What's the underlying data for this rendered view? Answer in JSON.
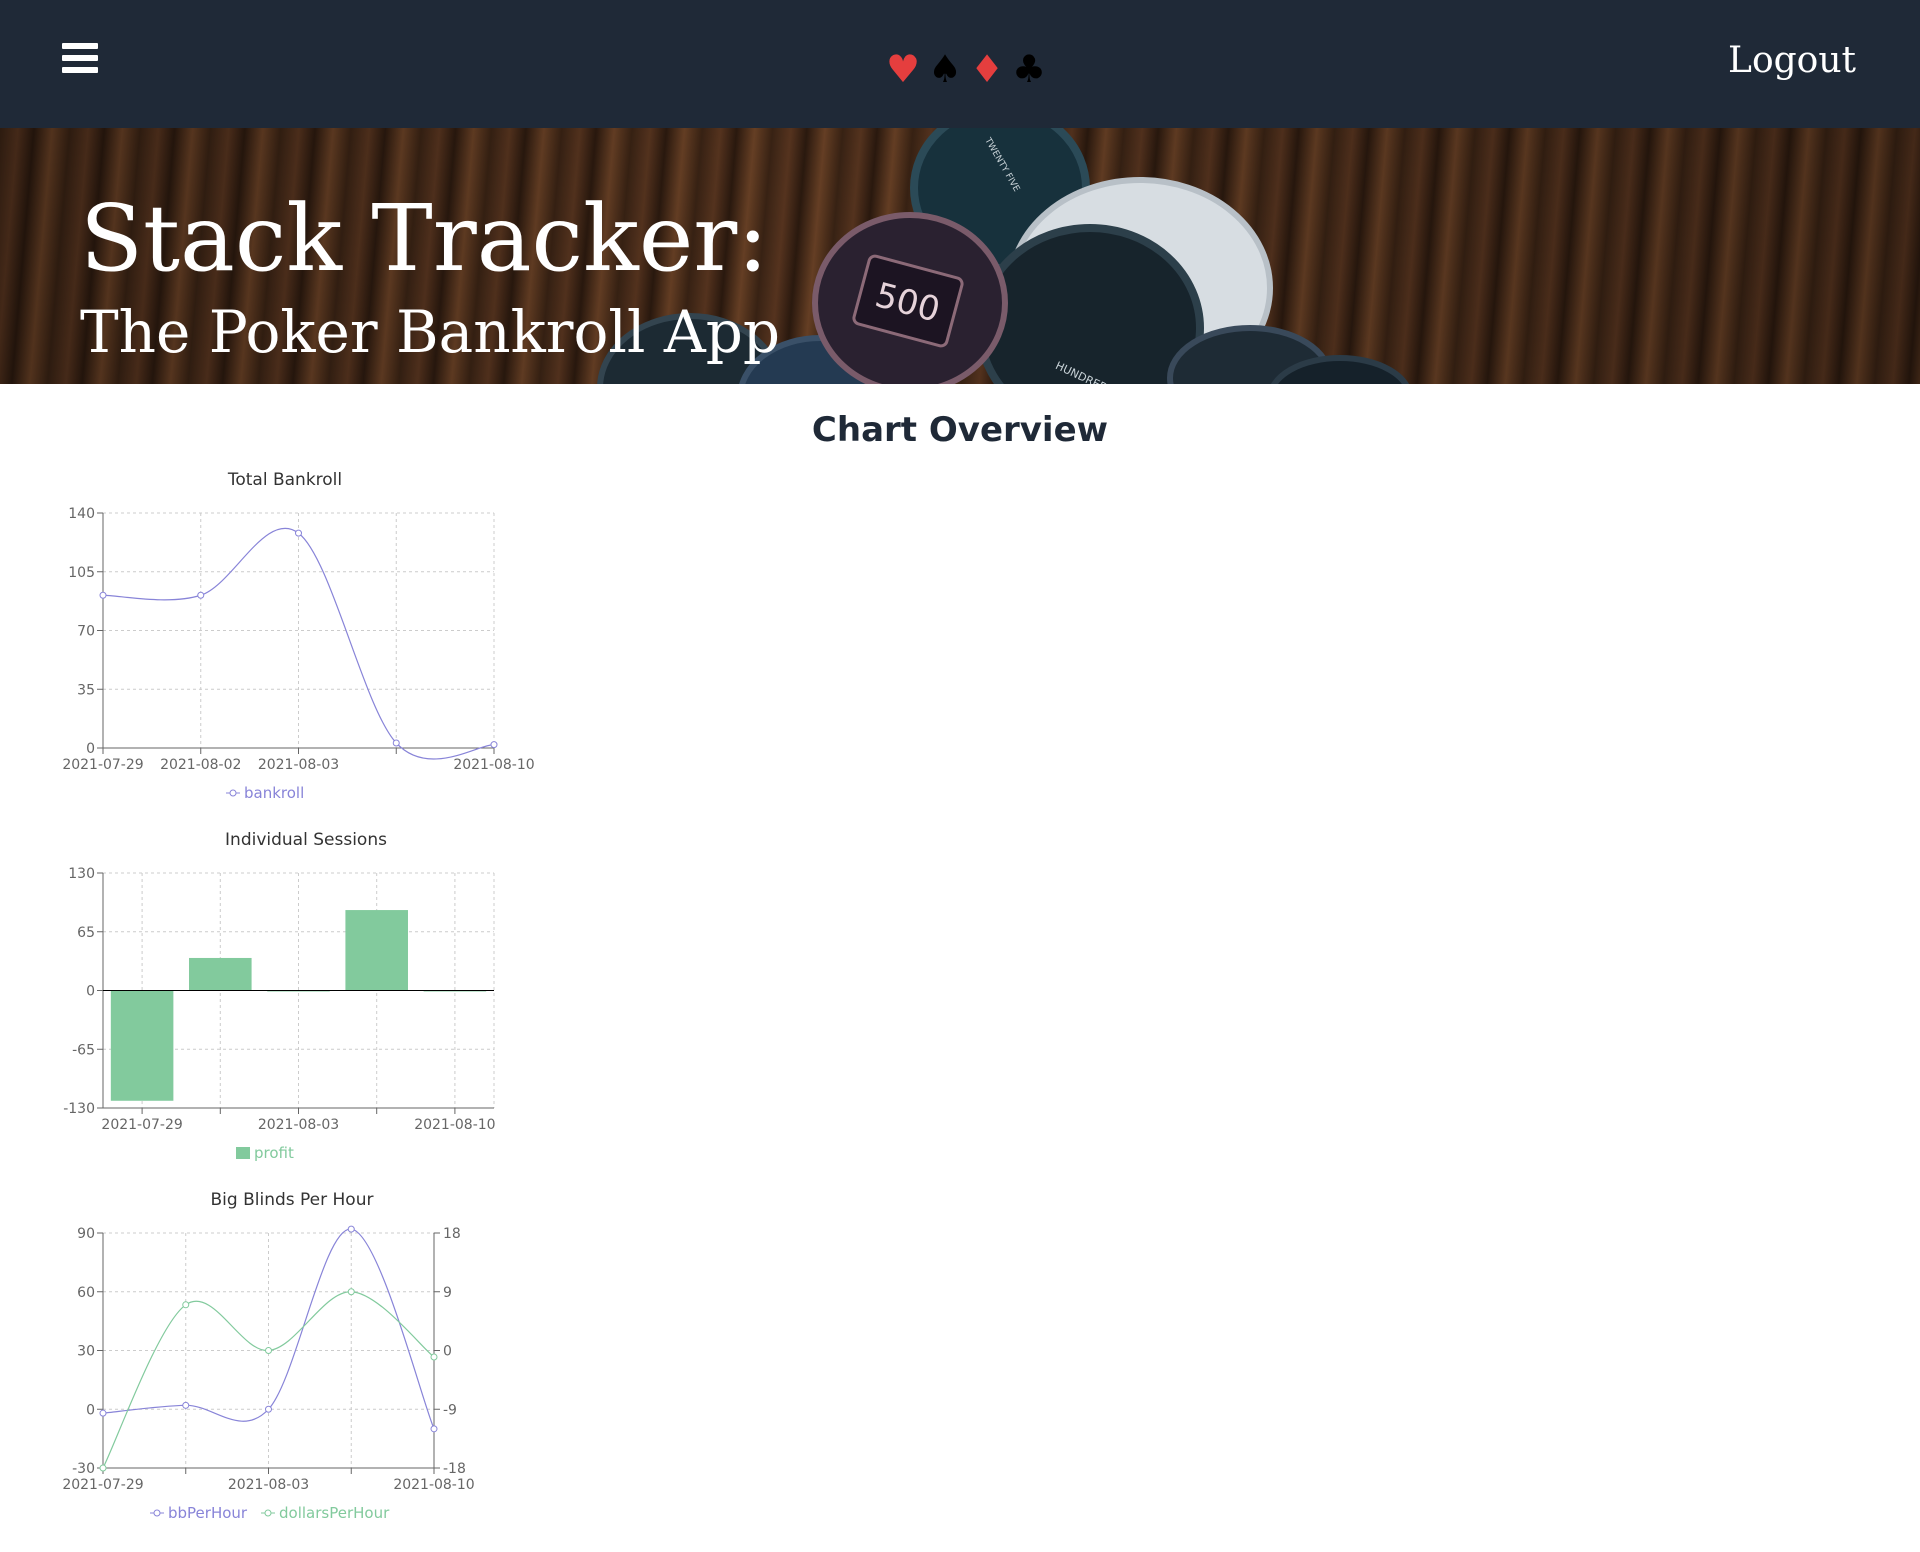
{
  "navbar": {
    "menu_icon": "hamburger-menu-icon",
    "suits": [
      {
        "symbol": "♥",
        "name": "heart-icon",
        "color": "#e53e3e"
      },
      {
        "symbol": "♠",
        "name": "spade-icon",
        "color": "#000000"
      },
      {
        "symbol": "♦",
        "name": "diamond-icon",
        "color": "#e53e3e"
      },
      {
        "symbol": "♣",
        "name": "club-icon",
        "color": "#000000"
      }
    ],
    "logout_label": "Logout",
    "background": "#1f2937"
  },
  "hero": {
    "title": "Stack Tracker:",
    "subtitle": "The Poker Bankroll App",
    "chip_labels": [
      "500",
      "TWENTY FIVE",
      "HUNDRED"
    ]
  },
  "main": {
    "title": "Chart Overview"
  },
  "chart_data": [
    {
      "type": "line",
      "title": "Total Bankroll",
      "x": [
        "2021-07-29",
        "2021-08-02",
        "2021-08-03",
        "",
        "2021-08-10"
      ],
      "series": [
        {
          "name": "bankroll",
          "color": "#8884d8",
          "values": [
            91,
            91,
            128,
            3,
            2
          ]
        }
      ],
      "ylim": [
        0,
        140
      ],
      "yticks": [
        0,
        35,
        70,
        105,
        140
      ],
      "grid": true,
      "legend": "bottom"
    },
    {
      "type": "bar",
      "title": "Individual Sessions",
      "categories": [
        "2021-07-29",
        "",
        "2021-08-03",
        "",
        "2021-08-10"
      ],
      "series": [
        {
          "name": "profit",
          "color": "#82ca9d",
          "values": [
            -122,
            36,
            0,
            89,
            -1
          ]
        }
      ],
      "ylim": [
        -130,
        130
      ],
      "yticks": [
        -130,
        -65,
        0,
        65,
        130
      ],
      "grid": true,
      "legend": "bottom"
    },
    {
      "type": "line",
      "title": "Big Blinds Per Hour",
      "x": [
        "2021-07-29",
        "",
        "2021-08-03",
        "",
        "2021-08-10"
      ],
      "series": [
        {
          "name": "bbPerHour",
          "color": "#8884d8",
          "axis": "left",
          "values": [
            -2,
            2,
            0,
            92,
            -10
          ]
        },
        {
          "name": "dollarsPerHour",
          "color": "#82ca9d",
          "axis": "right",
          "values": [
            -18,
            7,
            0,
            9,
            -1
          ]
        }
      ],
      "ylim": [
        -30,
        90
      ],
      "yticks": [
        -30,
        0,
        30,
        60,
        90
      ],
      "y2lim": [
        -18,
        18
      ],
      "y2ticks": [
        -18,
        -9,
        0,
        9,
        18
      ],
      "grid": true,
      "legend": "bottom"
    }
  ]
}
